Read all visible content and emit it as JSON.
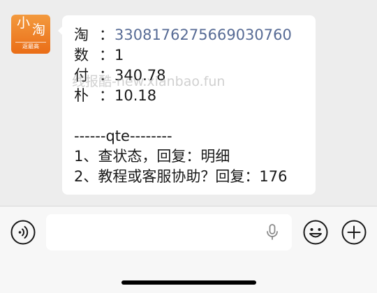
{
  "avatar": {
    "logo_main_1": "小",
    "logo_main_2": "淘",
    "logo_sub": "返最高"
  },
  "message": {
    "lines": [
      {
        "key": "淘",
        "colon": "：",
        "value": "330817627566903076​0"
      },
      {
        "key": "数",
        "colon": "：",
        "value": "1"
      },
      {
        "key": "付",
        "colon": "：",
        "value": "340.78"
      },
      {
        "key": "朴",
        "colon": "：",
        "value": "10.18"
      }
    ],
    "separator": "------qte--------",
    "instruction_1": "1、查状态，回复：明细",
    "instruction_2": "2、教程或客服协助？回复：176"
  },
  "watermark": "线报酷-new.xianbao.fun",
  "input": {
    "placeholder": ""
  },
  "icons": {
    "voice": "voice-icon",
    "mic": "mic-icon",
    "emoji": "emoji-icon",
    "plus": "plus-icon"
  },
  "colors": {
    "link": "#576b95",
    "avatar": "#ea6d17",
    "background": "#ededed"
  }
}
